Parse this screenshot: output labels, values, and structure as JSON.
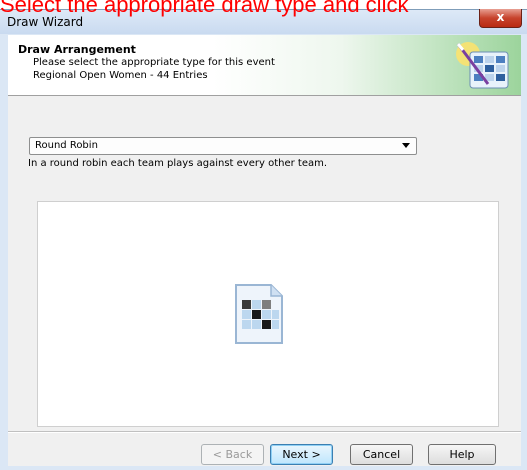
{
  "instruction_text": "Select the appropriate draw type and click",
  "window": {
    "title": "Draw Wizard",
    "close_label": "x"
  },
  "header": {
    "title": "Draw Arrangement",
    "line1": "Please select the appropriate type for this event",
    "line2": "Regional Open Women - 44 Entries",
    "icon": "wizard-wand-icon"
  },
  "draw_type": {
    "selected": "Round Robin",
    "description": "In a round robin each team plays against every other team."
  },
  "preview": {
    "icon": "round-robin-grid-icon"
  },
  "buttons": {
    "back": "< Back",
    "next": "Next >",
    "cancel": "Cancel",
    "help": "Help"
  },
  "colors": {
    "instruction": "#ff0000",
    "close_button": "#c7432c",
    "header_gradient_end": "#9cd49c"
  }
}
